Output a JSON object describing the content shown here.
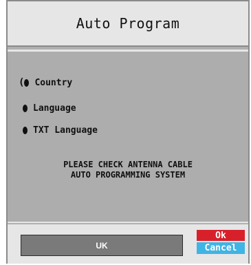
{
  "dialog": {
    "title": "Auto Program"
  },
  "menu": {
    "items": [
      {
        "label": "Country",
        "selected": true
      },
      {
        "label": "Language",
        "selected": false
      },
      {
        "label": "TXT Language",
        "selected": false
      }
    ]
  },
  "message": {
    "line1": "PLEASE CHECK ANTENNA CABLE",
    "line2": "AUTO PROGRAMMING SYSTEM"
  },
  "footer": {
    "value": "UK",
    "ok_label": "Ok",
    "cancel_label": "Cancel"
  },
  "colors": {
    "panel": "#adadad",
    "title_bg": "#e6e6e6",
    "value_box": "#7a7a7a",
    "ok": "#d8202a",
    "cancel": "#40b4e4"
  }
}
